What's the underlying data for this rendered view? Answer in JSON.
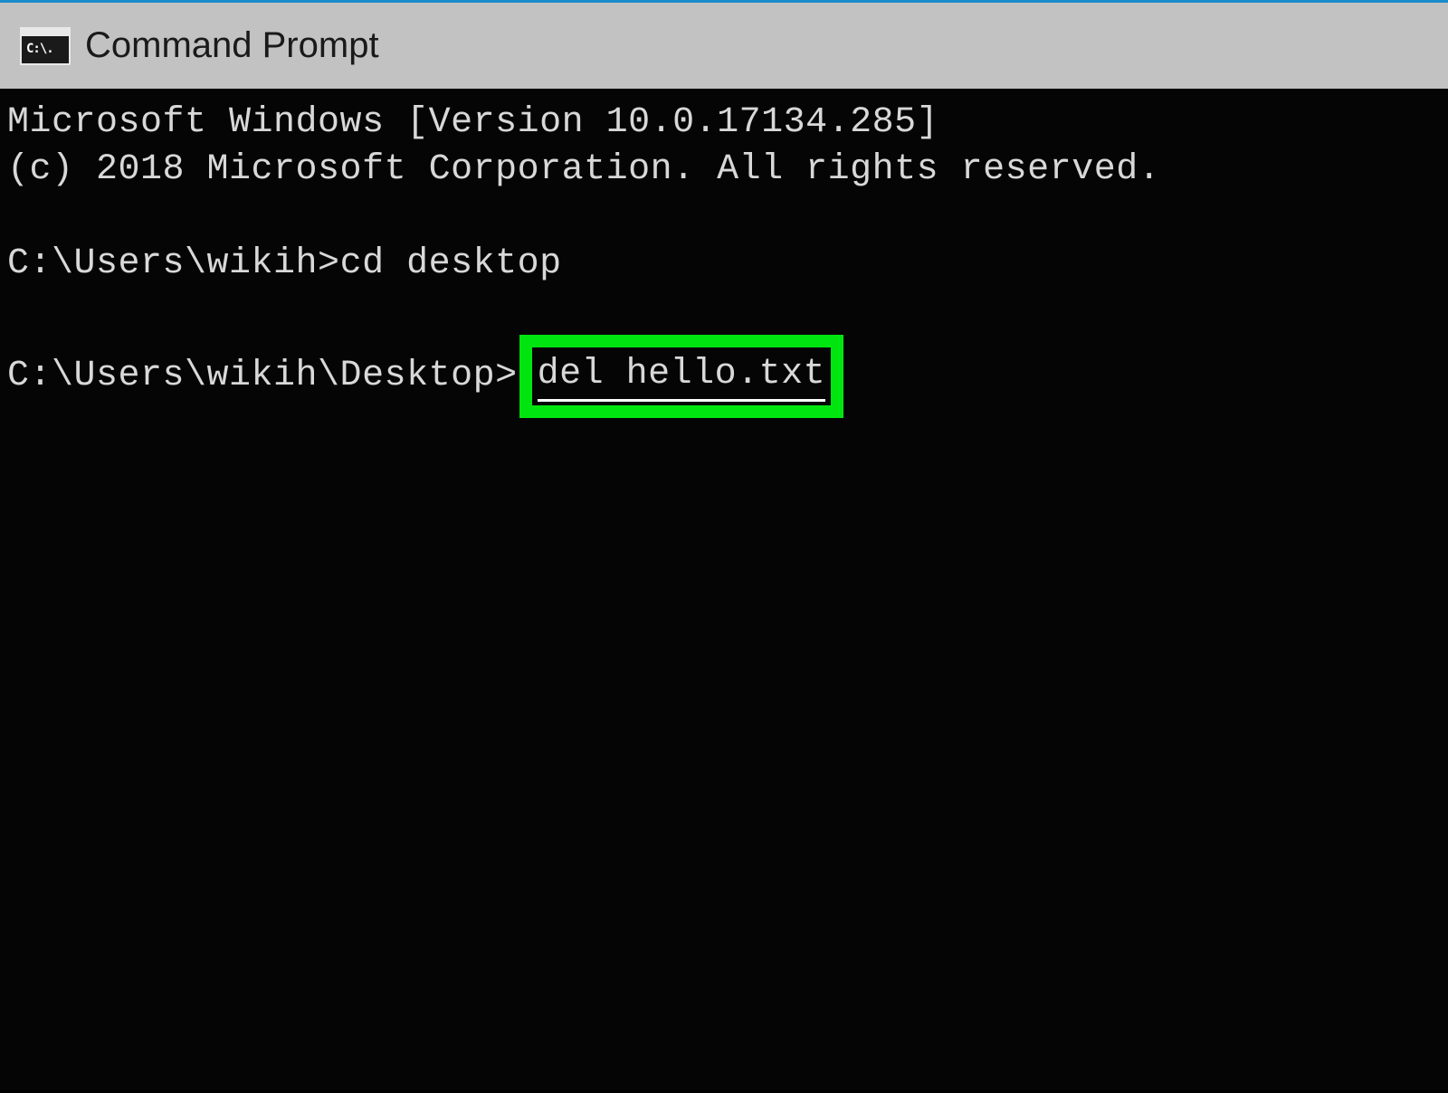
{
  "window": {
    "title": "Command Prompt",
    "icon_label": "C:\\."
  },
  "terminal": {
    "banner_line1": "Microsoft Windows [Version 10.0.17134.285]",
    "banner_line2": "(c) 2018 Microsoft Corporation. All rights reserved.",
    "prompt1": "C:\\Users\\wikih>",
    "command1": "cd desktop",
    "prompt2": "C:\\Users\\wikih\\Desktop>",
    "command2_highlighted": "del hello.txt"
  },
  "colors": {
    "highlight_border": "#00e510",
    "titlebar_bg": "#c2c2c2",
    "terminal_bg": "#050505",
    "terminal_fg": "#d8d8d8",
    "top_accent": "#1a8cc9"
  }
}
